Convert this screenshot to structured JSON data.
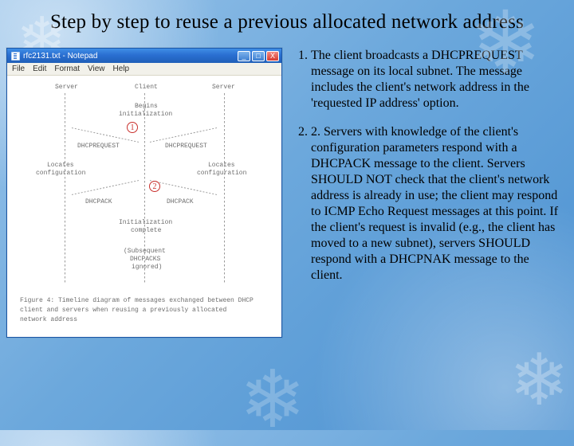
{
  "slide": {
    "title": "Step by step to reuse a previous allocated network address"
  },
  "window": {
    "title": "rfc2131.txt - Notepad",
    "menu": {
      "file": "File",
      "edit": "Edit",
      "format": "Format",
      "view": "View",
      "help": "Help"
    },
    "buttons": {
      "min": "_",
      "max": "□",
      "close": "X"
    }
  },
  "diagram": {
    "server_l": "Server",
    "client": "Client",
    "server_r": "Server",
    "begins": "Begins",
    "init": "initialization",
    "req_l": "DHCPREQUEST",
    "req_r": "DHCPREQUEST",
    "locates_l_a": "Locates",
    "locates_l_b": "configuration",
    "locates_r_a": "Locates",
    "locates_r_b": "configuration",
    "ack_l": "DHCPACK",
    "ack_r": "DHCPACK",
    "init_complete_a": "Initialization",
    "init_complete_b": "complete",
    "subseq_a": "(Subsequent",
    "subseq_b": "DHCPACKS",
    "subseq_c": "ignored)",
    "caption_a": "Figure 4: Timeline diagram of messages exchanged between DHCP",
    "caption_b": "client and servers when reusing a previously allocated",
    "caption_c": "network address",
    "marker1": "1",
    "marker2": "2"
  },
  "steps": {
    "one": "The client broadcasts a DHCPREQUEST message on its local subnet. The message includes the client's network address in the 'requested IP address' option.",
    "two": "2. Servers with knowledge of the client's configuration parameters respond with a DHCPACK message to the client. Servers SHOULD NOT check that the client's network address is already in use; the client may respond to ICMP Echo Request messages at this point. If the client's request is invalid (e.g., the client has moved to a new subnet), servers SHOULD respond with a DHCPNAK message to the client."
  }
}
